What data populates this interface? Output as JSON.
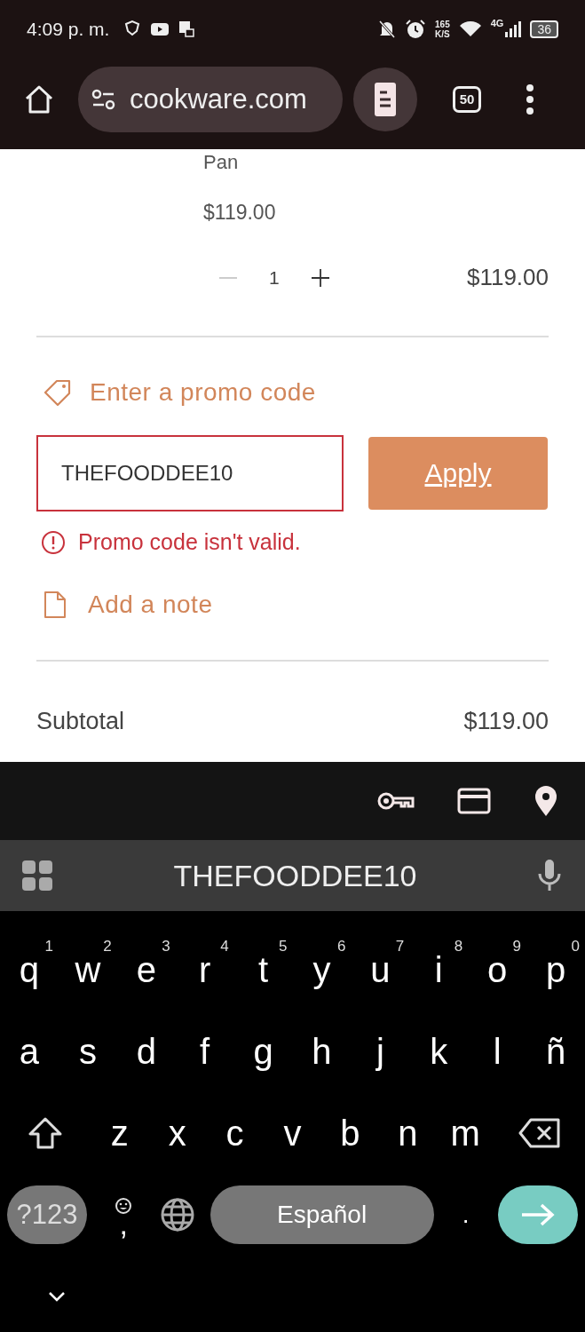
{
  "status_bar": {
    "time": "4:09 p. m.",
    "speed_value": "165",
    "speed_unit": "K/S",
    "network": "4G",
    "battery": "36"
  },
  "browser": {
    "url": "cookware.com",
    "tab_count": "50"
  },
  "cart_item": {
    "name": "Pan",
    "price": "$119.00",
    "quantity": "1",
    "line_total": "$119.00"
  },
  "promo": {
    "link": "Enter a promo code",
    "value": "THEFOODDEE10",
    "error": true,
    "button": "Apply",
    "error_message": "Promo code isn't valid."
  },
  "note_link": "Add a note",
  "subtotal": {
    "label": "Subtotal",
    "value": "$119.00"
  },
  "keyboard": {
    "suggestion": "THEFOODDEE10",
    "rows": [
      [
        {
          "label": "q",
          "hint": "1"
        },
        {
          "label": "w",
          "hint": "2"
        },
        {
          "label": "e",
          "hint": "3"
        },
        {
          "label": "r",
          "hint": "4"
        },
        {
          "label": "t",
          "hint": "5"
        },
        {
          "label": "y",
          "hint": "6"
        },
        {
          "label": "u",
          "hint": "7"
        },
        {
          "label": "i",
          "hint": "8"
        },
        {
          "label": "o",
          "hint": "9"
        },
        {
          "label": "p",
          "hint": "0"
        }
      ],
      [
        {
          "label": "a"
        },
        {
          "label": "s"
        },
        {
          "label": "d"
        },
        {
          "label": "f"
        },
        {
          "label": "g"
        },
        {
          "label": "h"
        },
        {
          "label": "j"
        },
        {
          "label": "k"
        },
        {
          "label": "l"
        },
        {
          "label": "ñ"
        }
      ],
      [
        {
          "label": "z"
        },
        {
          "label": "x"
        },
        {
          "label": "c"
        },
        {
          "label": "v"
        },
        {
          "label": "b"
        },
        {
          "label": "n"
        },
        {
          "label": "m"
        }
      ]
    ],
    "symbols_key": "?123",
    "comma_key": ",",
    "space_key": "Español",
    "period_key": "."
  }
}
